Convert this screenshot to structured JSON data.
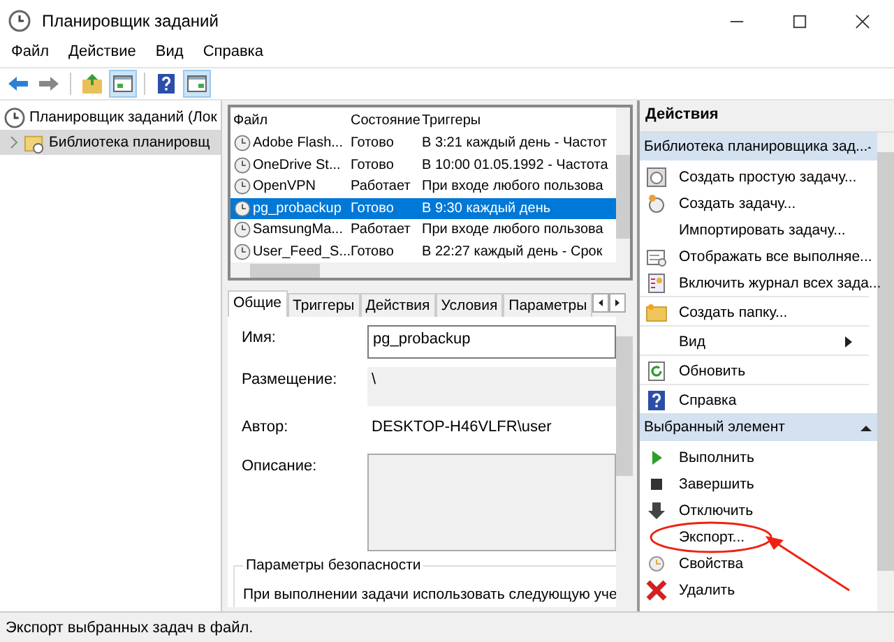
{
  "window": {
    "title": "Планировщик заданий"
  },
  "menu": [
    "Файл",
    "Действие",
    "Вид",
    "Справка"
  ],
  "tree": [
    {
      "label": "Планировщик заданий (Лок",
      "selected": false,
      "children": [
        {
          "label": "Библиотека планировщ",
          "selected": true,
          "expanded": false
        }
      ]
    }
  ],
  "task_table": {
    "columns": [
      "Файл",
      "Состояние",
      "Триггеры"
    ],
    "rows": [
      {
        "cells": [
          "Adobe Flash...",
          "Готово",
          "В 3:21 каждый день - Частот"
        ],
        "selected": false
      },
      {
        "cells": [
          "OneDrive St...",
          "Готово",
          "В 10:00 01.05.1992 - Частота"
        ],
        "selected": false
      },
      {
        "cells": [
          "OpenVPN",
          "Работает",
          "При входе любого пользова"
        ],
        "selected": false
      },
      {
        "cells": [
          "pg_probackup",
          "Готово",
          "В 9:30 каждый день"
        ],
        "selected": true
      },
      {
        "cells": [
          "SamsungMa...",
          "Работает",
          "При входе любого пользова"
        ],
        "selected": false
      },
      {
        "cells": [
          "User_Feed_S...",
          "Готово",
          "В 22:27 каждый день - Срок"
        ],
        "selected": false
      }
    ]
  },
  "detail_tabs": [
    {
      "label": "Общие",
      "selected": true
    },
    {
      "label": "Триггеры",
      "selected": false
    },
    {
      "label": "Действия",
      "selected": false
    },
    {
      "label": "Условия",
      "selected": false
    },
    {
      "label": "Параметры",
      "selected": false
    }
  ],
  "general": {
    "name_label": "Имя:",
    "name_value": "pg_probackup",
    "location_label": "Размещение:",
    "location_value": "\\",
    "author_label": "Автор:",
    "author_value": "DESKTOP-H46VLFR\\user",
    "description_label": "Описание:",
    "security_title": "Параметры безопасности",
    "security_text": "При выполнении задачи использовать следующую уче"
  },
  "actions": {
    "title": "Действия",
    "sections": [
      {
        "header": "Библиотека планировщика зад...",
        "items": [
          {
            "label": "Создать простую задачу...",
            "kind": "action",
            "separator_after": false,
            "highlighted": false
          },
          {
            "label": "Создать задачу...",
            "kind": "action",
            "separator_after": false,
            "highlighted": false
          },
          {
            "label": "Импортировать задачу...",
            "kind": "action",
            "separator_after": false,
            "highlighted": false
          },
          {
            "label": "Отображать все выполняе...",
            "kind": "action",
            "separator_after": false,
            "highlighted": false
          },
          {
            "label": "Включить журнал всех зада...",
            "kind": "action",
            "separator_after": true,
            "highlighted": false
          },
          {
            "label": "Создать папку...",
            "kind": "action",
            "separator_after": true,
            "highlighted": false
          },
          {
            "label": "Вид",
            "kind": "submenu",
            "separator_after": true,
            "highlighted": false
          },
          {
            "label": "Обновить",
            "kind": "action",
            "separator_after": true,
            "highlighted": false
          },
          {
            "label": "Справка",
            "kind": "action",
            "separator_after": false,
            "highlighted": false
          }
        ]
      },
      {
        "header": "Выбранный элемент",
        "items": [
          {
            "label": "Выполнить",
            "kind": "action",
            "separator_after": false,
            "highlighted": false
          },
          {
            "label": "Завершить",
            "kind": "action",
            "separator_after": false,
            "highlighted": false
          },
          {
            "label": "Отключить",
            "kind": "action",
            "separator_after": false,
            "highlighted": false
          },
          {
            "label": "Экспорт...",
            "kind": "action",
            "separator_after": false,
            "highlighted": true
          },
          {
            "label": "Свойства",
            "kind": "action",
            "separator_after": false,
            "highlighted": false
          },
          {
            "label": "Удалить",
            "kind": "action",
            "separator_after": false,
            "highlighted": false
          }
        ]
      }
    ]
  },
  "status_bar": "Экспорт выбранных задач в файл."
}
